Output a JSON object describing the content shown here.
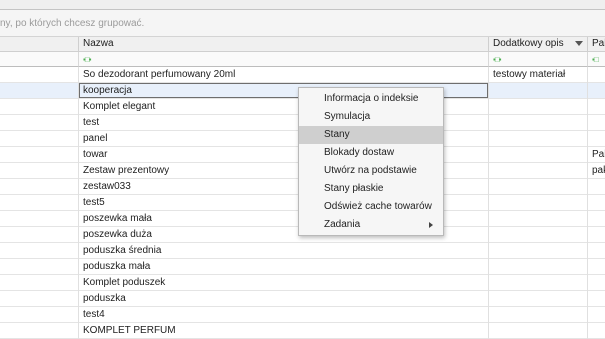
{
  "group_hint": "ny, po których chcesz grupować.",
  "columns": [
    {
      "label": ""
    },
    {
      "label": "Nazwa"
    },
    {
      "label": "Dodatkowy opis"
    },
    {
      "label": "Pak"
    }
  ],
  "filter_icon": "filter-icon",
  "rows": [
    {
      "nazwa": "So dezodorant perfumowany 20ml",
      "opis": "testowy materiał",
      "pak": ""
    },
    {
      "nazwa": "kooperacja",
      "opis": "",
      "pak": ""
    },
    {
      "nazwa": "Komplet elegant",
      "opis": "",
      "pak": ""
    },
    {
      "nazwa": "test",
      "opis": "",
      "pak": ""
    },
    {
      "nazwa": "panel",
      "opis": "",
      "pak": ""
    },
    {
      "nazwa": "towar",
      "opis": "",
      "pak": "Pak"
    },
    {
      "nazwa": "Zestaw prezentowy",
      "opis": "",
      "pak": "pak"
    },
    {
      "nazwa": "zestaw033",
      "opis": "",
      "pak": ""
    },
    {
      "nazwa": "test5",
      "opis": "",
      "pak": ""
    },
    {
      "nazwa": "poszewka mała",
      "opis": "",
      "pak": ""
    },
    {
      "nazwa": "poszewka duża",
      "opis": "",
      "pak": ""
    },
    {
      "nazwa": "poduszka średnia",
      "opis": "",
      "pak": ""
    },
    {
      "nazwa": "poduszka mała",
      "opis": "",
      "pak": ""
    },
    {
      "nazwa": "Komplet poduszek",
      "opis": "",
      "pak": ""
    },
    {
      "nazwa": "poduszka",
      "opis": "",
      "pak": ""
    },
    {
      "nazwa": "test4",
      "opis": "",
      "pak": ""
    },
    {
      "nazwa": "KOMPLET PERFUM",
      "opis": "",
      "pak": ""
    }
  ],
  "context_menu": {
    "items": [
      {
        "label": "Informacja o indeksie"
      },
      {
        "label": "Symulacja"
      },
      {
        "label": "Stany"
      },
      {
        "label": "Blokady dostaw"
      },
      {
        "label": "Utwórz na podstawie"
      },
      {
        "label": "Stany płaskie"
      },
      {
        "label": "Odśwież cache towarów"
      },
      {
        "label": "Zadania"
      }
    ],
    "highlighted_index": 2
  }
}
